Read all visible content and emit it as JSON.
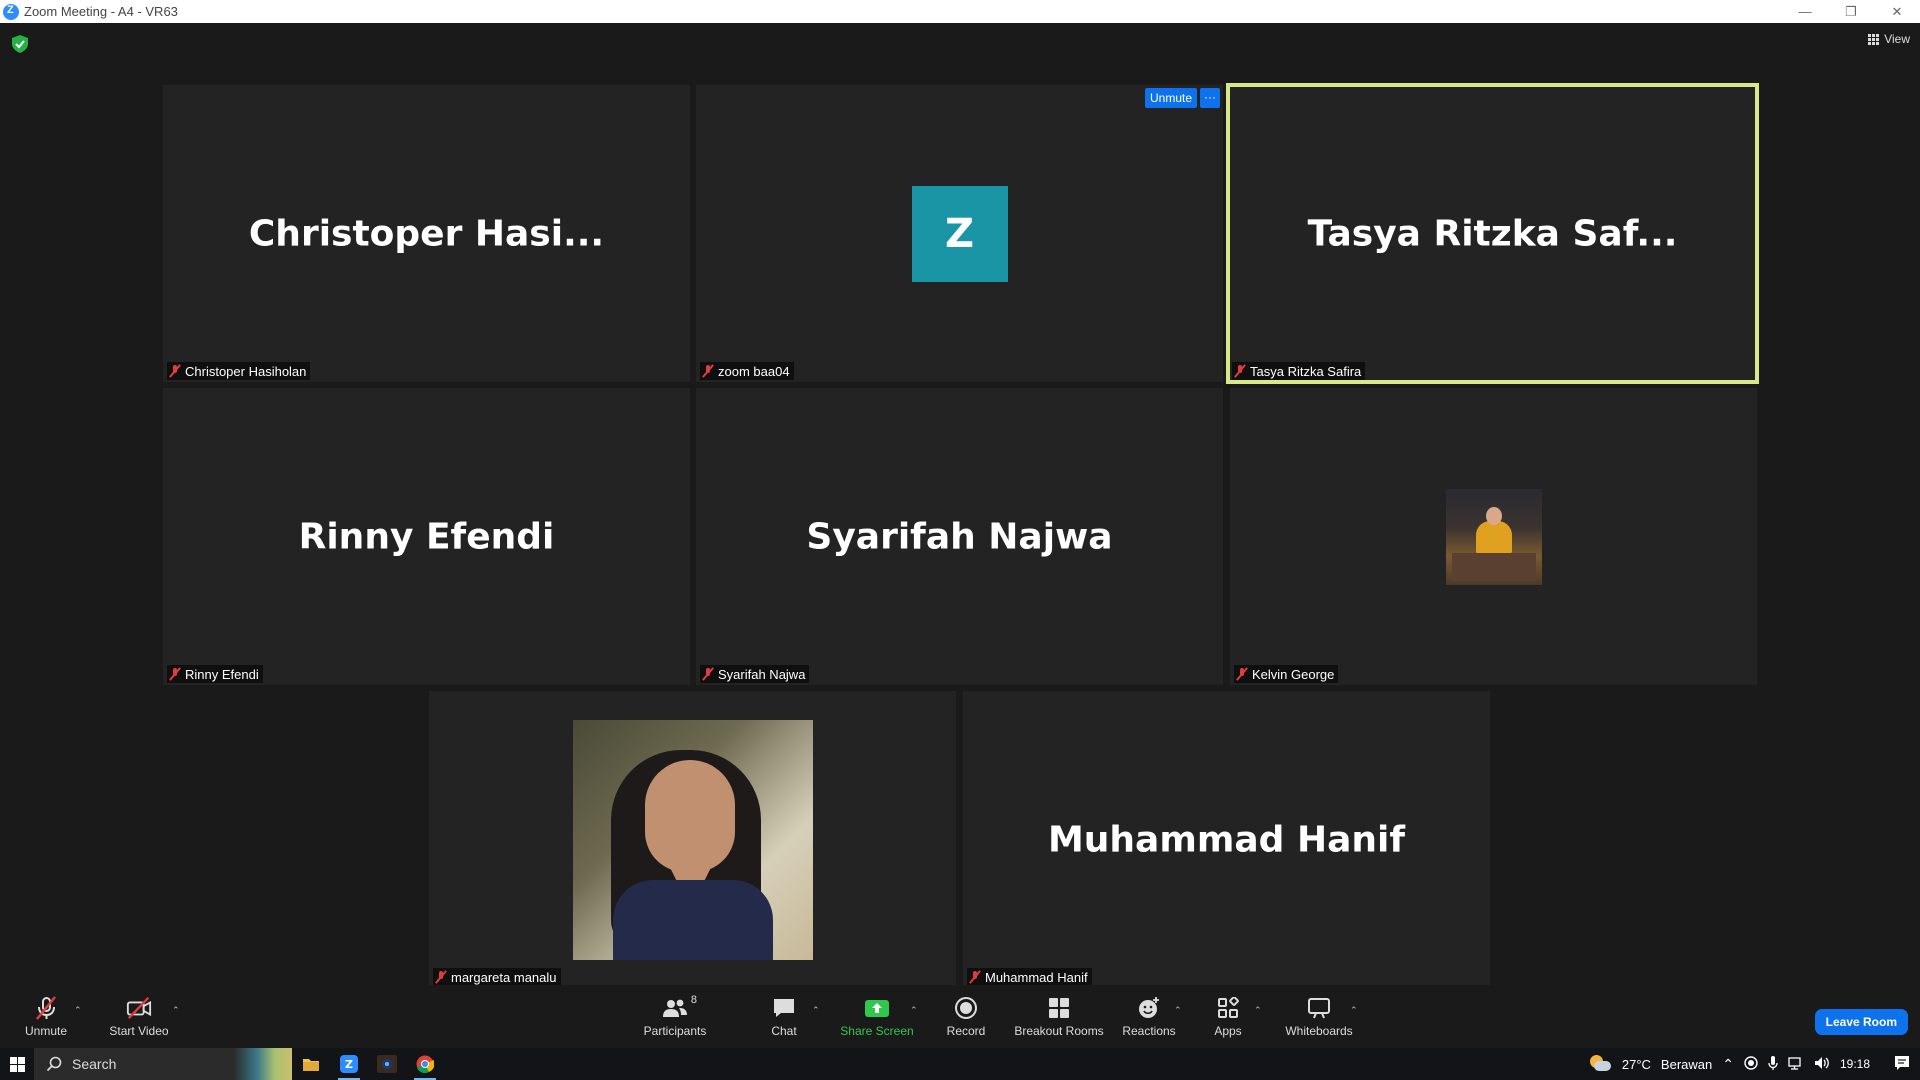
{
  "window": {
    "title": "Zoom Meeting - A4 - VR63"
  },
  "topbar": {
    "view_label": "View"
  },
  "tiles": [
    {
      "big_name": "Christoper  Hasi...",
      "label": "Christoper Hasiholan"
    },
    {
      "avatar_letter": "Z",
      "label": "zoom baa04"
    },
    {
      "big_name": "Tasya  Ritzka  Saf...",
      "label": "Tasya Ritzka Safira"
    },
    {
      "big_name": "Rinny Efendi",
      "label": "Rinny Efendi"
    },
    {
      "big_name": "Syarifah Najwa",
      "label": "Syarifah Najwa"
    },
    {
      "label": "Kelvin George"
    },
    {
      "label": "margareta manalu"
    },
    {
      "big_name": "Muhammad Hanif",
      "label": "Muhammad Hanif"
    }
  ],
  "unmute_chip": {
    "unmute_label": "Unmute",
    "more_label": "···"
  },
  "toolbar": {
    "unmute": "Unmute",
    "start_video": "Start Video",
    "participants": "Participants",
    "participants_count": "8",
    "chat": "Chat",
    "share_screen": "Share Screen",
    "record": "Record",
    "breakout_rooms": "Breakout Rooms",
    "reactions": "Reactions",
    "apps": "Apps",
    "whiteboards": "Whiteboards",
    "leave": "Leave Room"
  },
  "taskbar": {
    "search_label": "Search",
    "weather_temp": "27°C",
    "weather_desc": "Berawan",
    "time": "19:18"
  },
  "colors": {
    "accent": "#0e72ed",
    "active_speaker": "#d8e98a",
    "share_green": "#30c84c",
    "muted_red": "#e03d3d",
    "avatar_teal": "#1a95a6"
  }
}
